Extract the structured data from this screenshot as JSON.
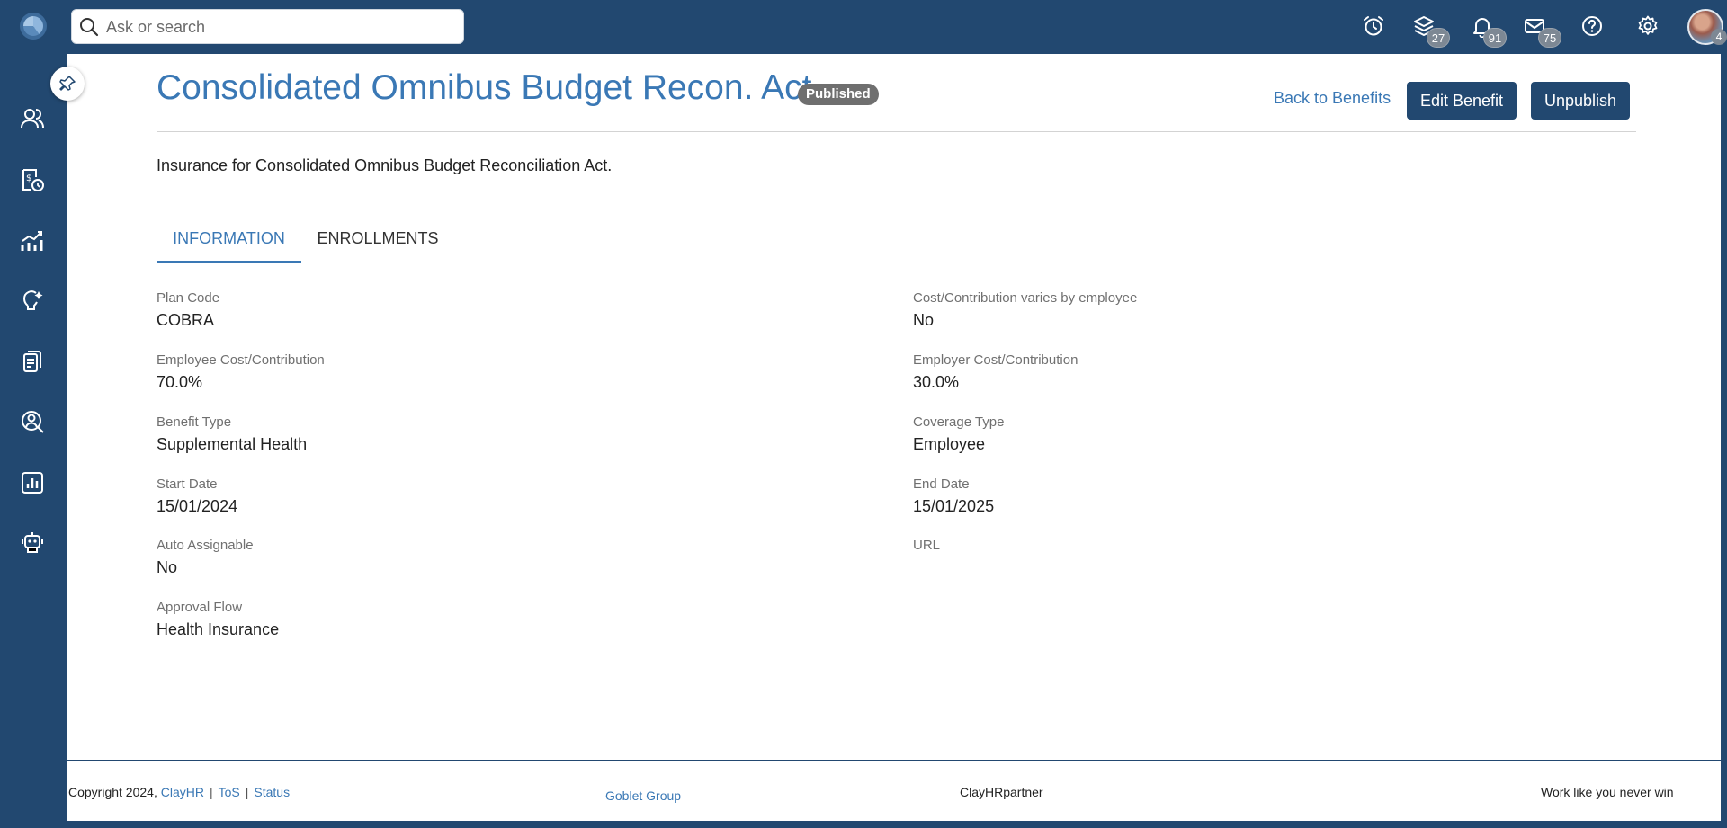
{
  "topbar": {
    "search_placeholder": "Ask or search",
    "icons": [
      {
        "name": "alarm-clock-icon"
      },
      {
        "name": "layers-icon",
        "badge": "27"
      },
      {
        "name": "bell-icon",
        "badge": "91"
      },
      {
        "name": "mail-icon",
        "badge": "75"
      },
      {
        "name": "help-icon"
      },
      {
        "name": "gear-icon"
      }
    ],
    "avatar_badge": "4"
  },
  "sidebar": {
    "icons": [
      "people-icon",
      "payroll-clock-icon",
      "growth-chart-icon",
      "lightbulb-icon",
      "documents-icon",
      "person-search-icon",
      "report-chart-icon",
      "robot-icon"
    ]
  },
  "page": {
    "title": "Consolidated Omnibus Budget Recon. Act",
    "status": "Published",
    "back_link": "Back to Benefits",
    "edit_button": "Edit Benefit",
    "unpublish_button": "Unpublish",
    "description": "Insurance for Consolidated Omnibus Budget Reconciliation Act."
  },
  "tabs": {
    "information": "INFORMATION",
    "enrollments": "ENROLLMENTS",
    "active": "information"
  },
  "fields": {
    "plan_code": {
      "label": "Plan Code",
      "value": "COBRA"
    },
    "varies": {
      "label": "Cost/Contribution varies by employee",
      "value": "No"
    },
    "employee_cost": {
      "label": "Employee Cost/Contribution",
      "value": "70.0%"
    },
    "employer_cost": {
      "label": "Employer Cost/Contribution",
      "value": "30.0%"
    },
    "benefit_type": {
      "label": "Benefit Type",
      "value": "Supplemental Health"
    },
    "coverage_type": {
      "label": "Coverage Type",
      "value": "Employee"
    },
    "start_date": {
      "label": "Start Date",
      "value": "15/01/2024"
    },
    "end_date": {
      "label": "End Date",
      "value": "15/01/2025"
    },
    "auto_assignable": {
      "label": "Auto Assignable",
      "value": "No"
    },
    "url": {
      "label": "URL",
      "value": ""
    },
    "approval_flow": {
      "label": "Approval Flow",
      "value": "Health Insurance"
    }
  },
  "footer": {
    "copyright": "Copyright 2024,",
    "clayhr": "ClayHR",
    "tos": "ToS",
    "status": "Status",
    "goblet": "Goblet Group",
    "partner": "ClayHRpartner",
    "tagline": "Work like you never win",
    "separator": "|"
  },
  "colors": {
    "brand_navy": "#224870",
    "link_blue": "#3a78b5",
    "badge_gray": "#6f6f6f"
  }
}
